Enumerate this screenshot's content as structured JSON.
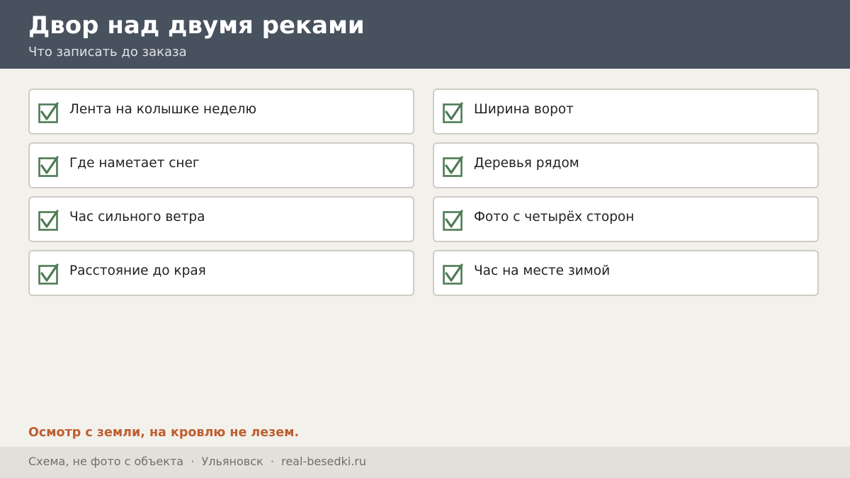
{
  "header": {
    "title": "Двор над двумя реками",
    "subtitle": "Что записать до заказа"
  },
  "checklist": {
    "items": [
      {
        "label": "Лента на колышке неделю",
        "checked": true
      },
      {
        "label": "Ширина ворот",
        "checked": true
      },
      {
        "label": "Где наметает снег",
        "checked": true
      },
      {
        "label": "Деревья рядом",
        "checked": true
      },
      {
        "label": "Час сильного ветра",
        "checked": true
      },
      {
        "label": "Фото с четырёх сторон",
        "checked": true
      },
      {
        "label": "Расстояние до края",
        "checked": true
      },
      {
        "label": "Час на месте зимой",
        "checked": true
      }
    ]
  },
  "note": "Осмотр с земли, на кровлю не лезем.",
  "footer": {
    "items": [
      "Схема, не фото с объекта",
      "Ульяновск",
      "real-besedki.ru"
    ],
    "separator": "·"
  },
  "colors": {
    "header_bg": "#48515e",
    "page_bg": "#f3f1ec",
    "check_green": "#4e7b55",
    "note_accent": "#bd5e30",
    "footer_bg": "#e3e0da"
  },
  "icons": {
    "checkbox": "checked-checkbox-icon"
  }
}
